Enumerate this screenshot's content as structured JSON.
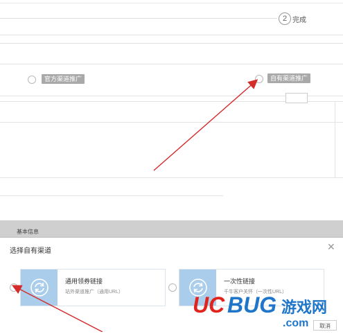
{
  "steps": {
    "step2_number": "2",
    "step2_label": "完成"
  },
  "channel_options": [
    {
      "label": "官方渠道推广",
      "selected": false
    },
    {
      "label": "自有渠道推广",
      "selected": false
    }
  ],
  "section": {
    "title": "基本信息"
  },
  "dialog": {
    "title": "选择自有渠道",
    "close_symbol": "✕",
    "cancel_label": "取消",
    "options": [
      {
        "title": "通用领券链接",
        "desc": "站外渠道推广（通用URL）",
        "icon": "refresh-icon"
      },
      {
        "title": "一次性链接",
        "desc": "千牛客户关怀（一次性URL）",
        "icon": "refresh-icon"
      }
    ]
  },
  "watermark": {
    "text": "UCBUG游戏网",
    "sub": ".com"
  },
  "colors": {
    "arrow": "#d42b2b",
    "tag_bg": "#a9a9a9",
    "icon_tile": "#a9cdea",
    "watermark_red": "#e0241b",
    "watermark_blue": "#1f76c9"
  }
}
